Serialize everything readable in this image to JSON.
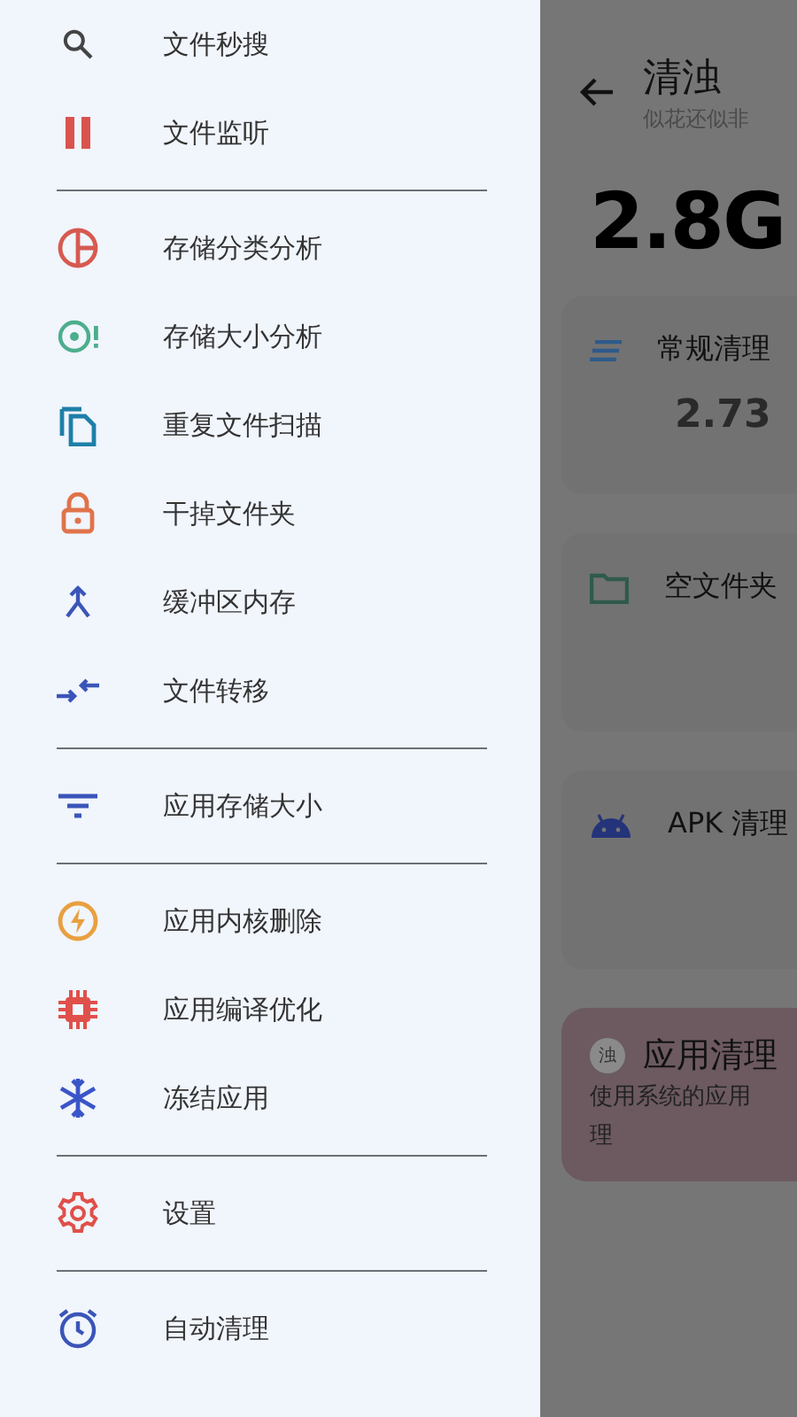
{
  "drawer": {
    "sections": [
      {
        "items": [
          {
            "kind": "search",
            "label": "文件秒搜"
          },
          {
            "kind": "pause",
            "label": "文件监听"
          }
        ]
      },
      {
        "items": [
          {
            "kind": "pie",
            "label": "存储分类分析"
          },
          {
            "kind": "target",
            "label": "存储大小分析"
          },
          {
            "kind": "copy",
            "label": "重复文件扫描"
          },
          {
            "kind": "lock",
            "label": "干掉文件夹"
          },
          {
            "kind": "merge",
            "label": "缓冲区内存"
          },
          {
            "kind": "swap",
            "label": "文件转移"
          }
        ]
      },
      {
        "items": [
          {
            "kind": "filter",
            "label": "应用存储大小"
          }
        ]
      },
      {
        "items": [
          {
            "kind": "bolt",
            "label": "应用内核删除"
          },
          {
            "kind": "chip",
            "label": "应用编译优化"
          },
          {
            "kind": "snow",
            "label": "冻结应用"
          }
        ]
      },
      {
        "items": [
          {
            "kind": "gear",
            "label": "设置"
          }
        ]
      },
      {
        "items": [
          {
            "kind": "alarm",
            "label": "自动清理"
          }
        ]
      }
    ]
  },
  "main": {
    "title": "清浊",
    "subtitle": "似花还似非",
    "total": "2.8G",
    "cards": [
      {
        "kind": "lines",
        "title": "常规清理",
        "value": "2.73"
      },
      {
        "kind": "folder",
        "title": "空文件夹"
      },
      {
        "kind": "android",
        "title": "APK 清理"
      }
    ],
    "app_card": {
      "avatar": "浊",
      "title": "应用清理",
      "lines": [
        "使用系统的应用",
        "理"
      ]
    }
  }
}
